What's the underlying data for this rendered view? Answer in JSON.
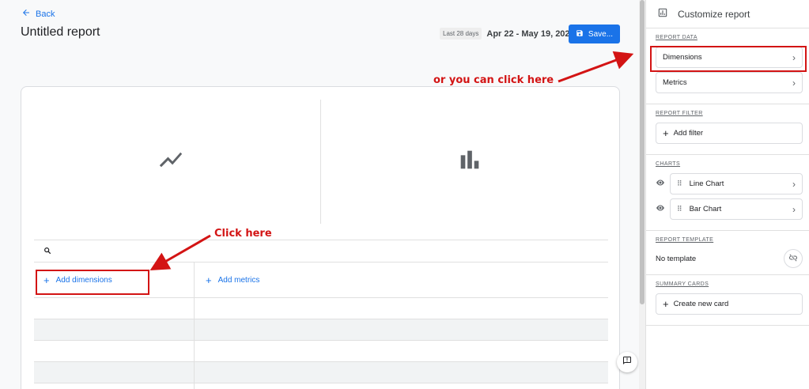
{
  "header": {
    "back_label": "Back",
    "title": "Untitled report",
    "date_label": "Last 28 days",
    "date_range": "Apr 22 - May 19, 2023",
    "save_label": "Save..."
  },
  "table": {
    "add_dimensions": "Add dimensions",
    "add_metrics": "Add metrics"
  },
  "panel": {
    "title": "Customize report",
    "report_data": {
      "title": "REPORT DATA",
      "items": [
        {
          "label": "Dimensions"
        },
        {
          "label": "Metrics"
        }
      ]
    },
    "report_filter": {
      "title": "REPORT FILTER",
      "add_label": "Add filter"
    },
    "charts": {
      "title": "CHARTS",
      "items": [
        {
          "label": "Line Chart"
        },
        {
          "label": "Bar Chart"
        }
      ]
    },
    "report_template": {
      "title": "REPORT TEMPLATE",
      "value": "No template"
    },
    "summary_cards": {
      "title": "SUMMARY CARDS",
      "add_label": "Create new card"
    }
  },
  "annotations": {
    "top": "or you can click here",
    "bottom": "Click here",
    "color": "#d31414"
  },
  "colors": {
    "accent": "#1a73e8"
  }
}
